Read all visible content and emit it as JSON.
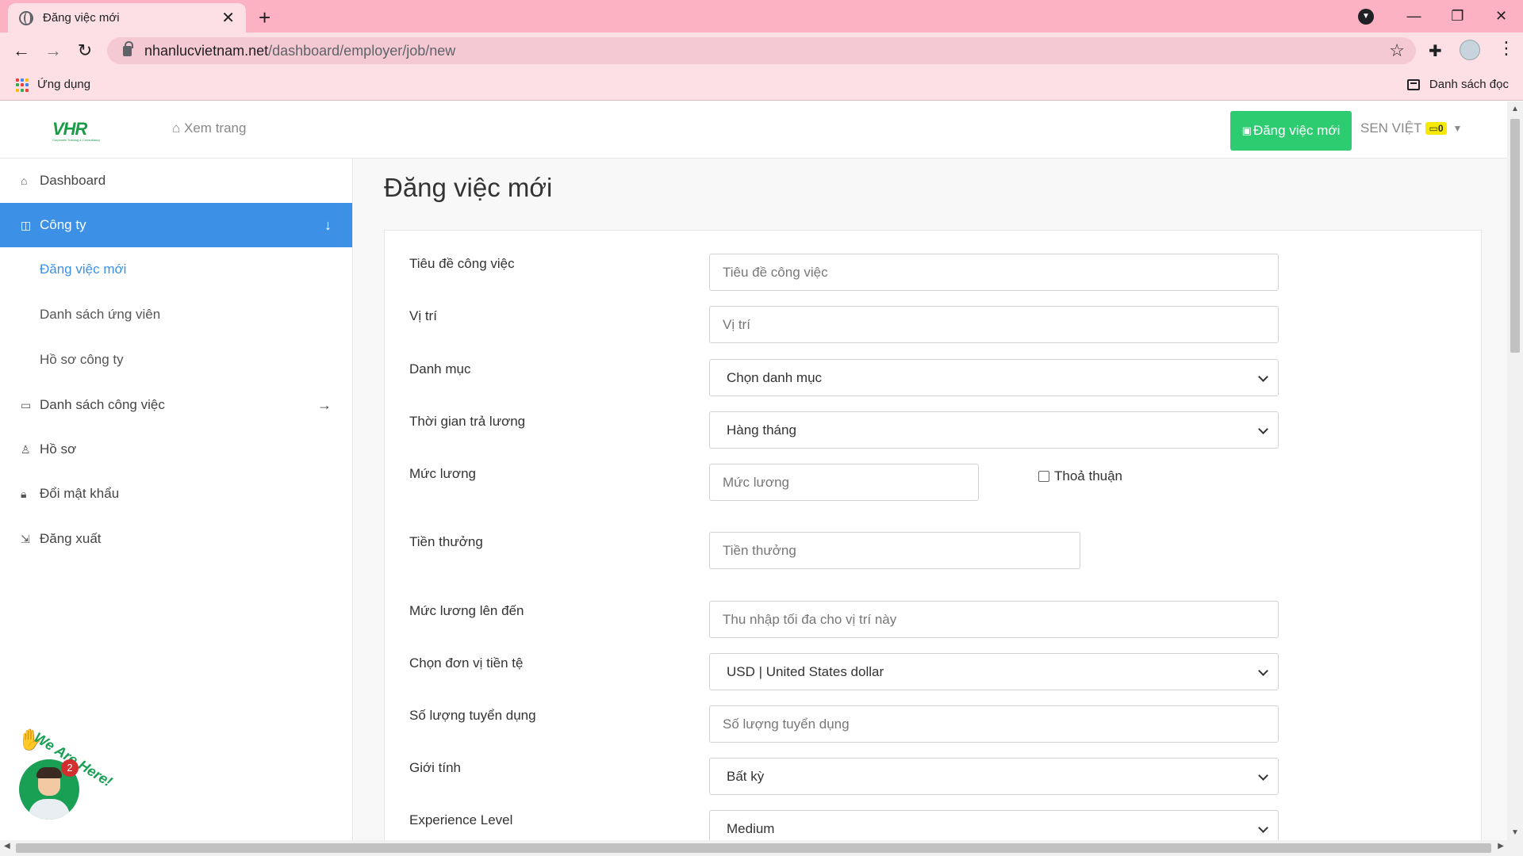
{
  "browser": {
    "tab_title": "Đăng việc mới",
    "tab_close": "✕",
    "new_tab": "+",
    "url_host": "nhanlucvietnam.net",
    "url_path": "/dashboard/employer/job/new",
    "bookmark_apps": "Ứng dụng",
    "reading_list": "Danh sách đọc"
  },
  "header": {
    "logo_text": "VHR",
    "logo_tagline": "Corporate Training & Consultancy",
    "view_site": "Xem trang",
    "post_button": "Đăng việc mới",
    "user_name": "SEN VIỆT",
    "user_badge": "0"
  },
  "sidebar": {
    "dashboard": "Dashboard",
    "company": "Công ty",
    "sub_post_job": "Đăng việc mới",
    "sub_candidates": "Danh sách ứng viên",
    "sub_company_profile": "Hồ sơ công ty",
    "job_list": "Danh sách công việc",
    "profile": "Hồ sơ",
    "change_password": "Đổi mật khẩu",
    "logout": "Đăng xuất"
  },
  "chat": {
    "badge": "2",
    "label": "We Are Here!"
  },
  "page": {
    "title": "Đăng việc mới"
  },
  "form": {
    "job_title_label": "Tiêu đề công việc",
    "job_title_placeholder": "Tiêu đề công việc",
    "position_label": "Vị trí",
    "position_placeholder": "Vị trí",
    "category_label": "Danh mục",
    "category_value": "Chọn danh mục",
    "pay_period_label": "Thời gian trả lương",
    "pay_period_value": "Hàng tháng",
    "salary_label": "Mức lương",
    "salary_placeholder": "Mức lương",
    "negotiable_label": "Thoả thuận",
    "bonus_label": "Tiền thưởng",
    "bonus_placeholder": "Tiền thưởng",
    "max_salary_label": "Mức lương lên đến",
    "max_salary_placeholder": "Thu nhập tối đa cho vị trí này",
    "currency_label": "Chọn đơn vị tiền tệ",
    "currency_value": "USD | United States dollar",
    "vacancies_label": "Số lượng tuyển dụng",
    "vacancies_placeholder": "Số lượng tuyển dụng",
    "gender_label": "Giới tính",
    "gender_value": "Bất kỳ",
    "experience_label": "Experience Level",
    "experience_value": "Medium"
  },
  "colors": {
    "tab_strip": "#fcb2c2",
    "toolbar": "#fde0e6",
    "accent_blue": "#3c91e6",
    "post_green": "#2ecc71"
  }
}
